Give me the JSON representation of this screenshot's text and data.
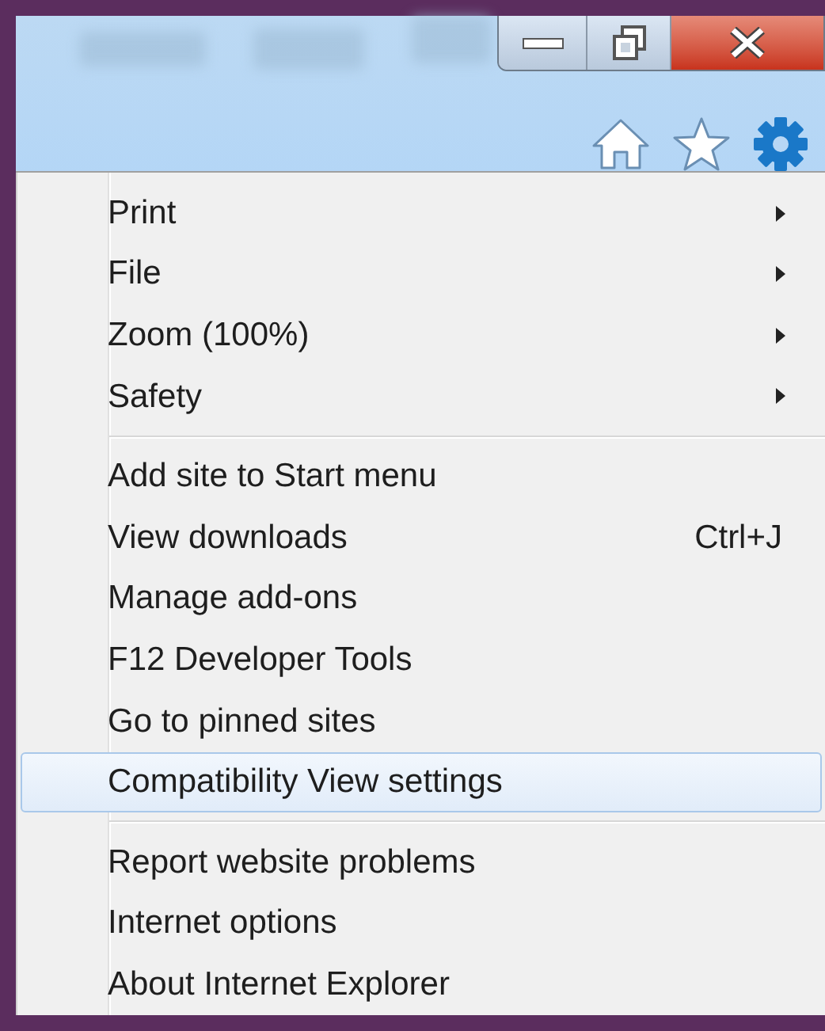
{
  "toolbar": {
    "buttons": [
      {
        "kind": "home"
      },
      {
        "kind": "favorites"
      },
      {
        "kind": "tools"
      }
    ]
  },
  "menu": {
    "groups": [
      {
        "items": [
          {
            "label": "Print",
            "submenu": true,
            "selected": false
          },
          {
            "label": "File",
            "submenu": true,
            "selected": false
          },
          {
            "label": "Zoom (100%)",
            "submenu": true,
            "selected": false
          },
          {
            "label": "Safety",
            "submenu": true,
            "selected": false
          }
        ]
      },
      {
        "items": [
          {
            "label": "Add site to Start menu",
            "submenu": false,
            "selected": false
          },
          {
            "label": "View downloads",
            "shortcut": "Ctrl+J",
            "submenu": false,
            "selected": false
          },
          {
            "label": "Manage add-ons",
            "submenu": false,
            "selected": false
          },
          {
            "label": "F12 Developer Tools",
            "submenu": false,
            "selected": false
          },
          {
            "label": "Go to pinned sites",
            "submenu": false,
            "selected": false
          },
          {
            "label": "Compatibility View settings",
            "submenu": false,
            "selected": true
          }
        ]
      },
      {
        "items": [
          {
            "label": "Report website problems",
            "submenu": false,
            "selected": false
          },
          {
            "label": "Internet options",
            "submenu": false,
            "selected": false
          },
          {
            "label": "About Internet Explorer",
            "submenu": false,
            "selected": false
          }
        ]
      }
    ]
  }
}
